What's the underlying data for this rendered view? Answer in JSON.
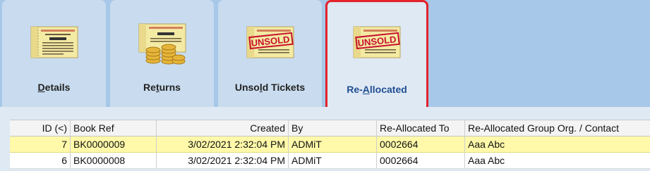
{
  "tabs": [
    {
      "label_pre": "",
      "label_u": "D",
      "label_post": "etails",
      "icon": "raffle-ticket-icon"
    },
    {
      "label_pre": "Re",
      "label_u": "t",
      "label_post": "urns",
      "icon": "ticket-coins-icon"
    },
    {
      "label_pre": "Unso",
      "label_u": "l",
      "label_post": "d Tickets",
      "icon": "unsold-ticket-icon"
    },
    {
      "label_pre": "Re-",
      "label_u": "A",
      "label_post": "llocated",
      "icon": "unsold-ticket-icon"
    }
  ],
  "ticket": {
    "line1": "INSTRUCTIONS FOR RESULTS",
    "line2": "RAFFLE",
    "stamp": "UNSOLD"
  },
  "colors": {
    "active_border": "#e2232a",
    "selected_row": "#fff9a9",
    "active_label": "#1f4e90"
  },
  "table": {
    "headers": [
      "ID (<)",
      "Book Ref",
      "Created",
      "By",
      "Re-Allocated To",
      "Re-Allocated Group Org. / Contact"
    ],
    "rows": [
      [
        "7",
        "BK0000009",
        "3/02/2021 2:32:04 PM",
        "ADMiT",
        "0002664",
        "Aaa Abc"
      ],
      [
        "6",
        "BK0000008",
        "3/02/2021 2:32:04 PM",
        "ADMiT",
        "0002664",
        "Aaa Abc"
      ]
    ]
  }
}
